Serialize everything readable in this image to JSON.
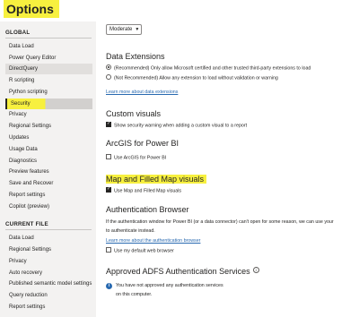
{
  "window": {
    "title": "Options"
  },
  "sidebar": {
    "global_heading": "GLOBAL",
    "global_items": [
      "Data Load",
      "Power Query Editor",
      "DirectQuery",
      "R scripting",
      "Python scripting",
      "Security",
      "Privacy",
      "Regional Settings",
      "Updates",
      "Usage Data",
      "Diagnostics",
      "Preview features",
      "Save and Recover",
      "Report settings",
      "Copilot (preview)"
    ],
    "current_heading": "CURRENT FILE",
    "current_items": [
      "Data Load",
      "Regional Settings",
      "Privacy",
      "Auto recovery",
      "Published semantic model settings",
      "Query reduction",
      "Report settings"
    ]
  },
  "main": {
    "level_dropdown": "Moderate",
    "data_extensions": {
      "heading": "Data Extensions",
      "option_recommended": "(Recommended) Only allow Microsoft certified and other trusted third-party extensions to load",
      "option_not_recommended": "(Not Recommended) Allow any extension to load without validation or warning",
      "link": "Learn more about data extensions"
    },
    "custom_visuals": {
      "heading": "Custom visuals",
      "checkbox": "Show security warning when adding a custom visual to a report"
    },
    "arcgis": {
      "heading": "ArcGIS for Power BI",
      "checkbox": "Use ArcGIS for Power BI"
    },
    "map_visuals": {
      "heading": "Map and Filled Map visuals",
      "checkbox": "Use Map and Filled Map visuals"
    },
    "auth_browser": {
      "heading": "Authentication Browser",
      "description_1": "If the authentication window for Power BI (or a data connector) can't open for some reason, we can use your",
      "description_2": "to authenticate instead.",
      "link": "Learn more about the authentication browser",
      "checkbox": "Use my default web browser"
    },
    "adfs": {
      "heading": "Approved ADFS Authentication Services",
      "info_line_1": "You have not approved any authentication services",
      "info_line_2": "on this computer."
    }
  },
  "colors": {
    "highlight": "#f7f03f",
    "link": "#2869b0",
    "sidebar_bg": "#f3f2f1",
    "selected": "#d2d0ce"
  }
}
